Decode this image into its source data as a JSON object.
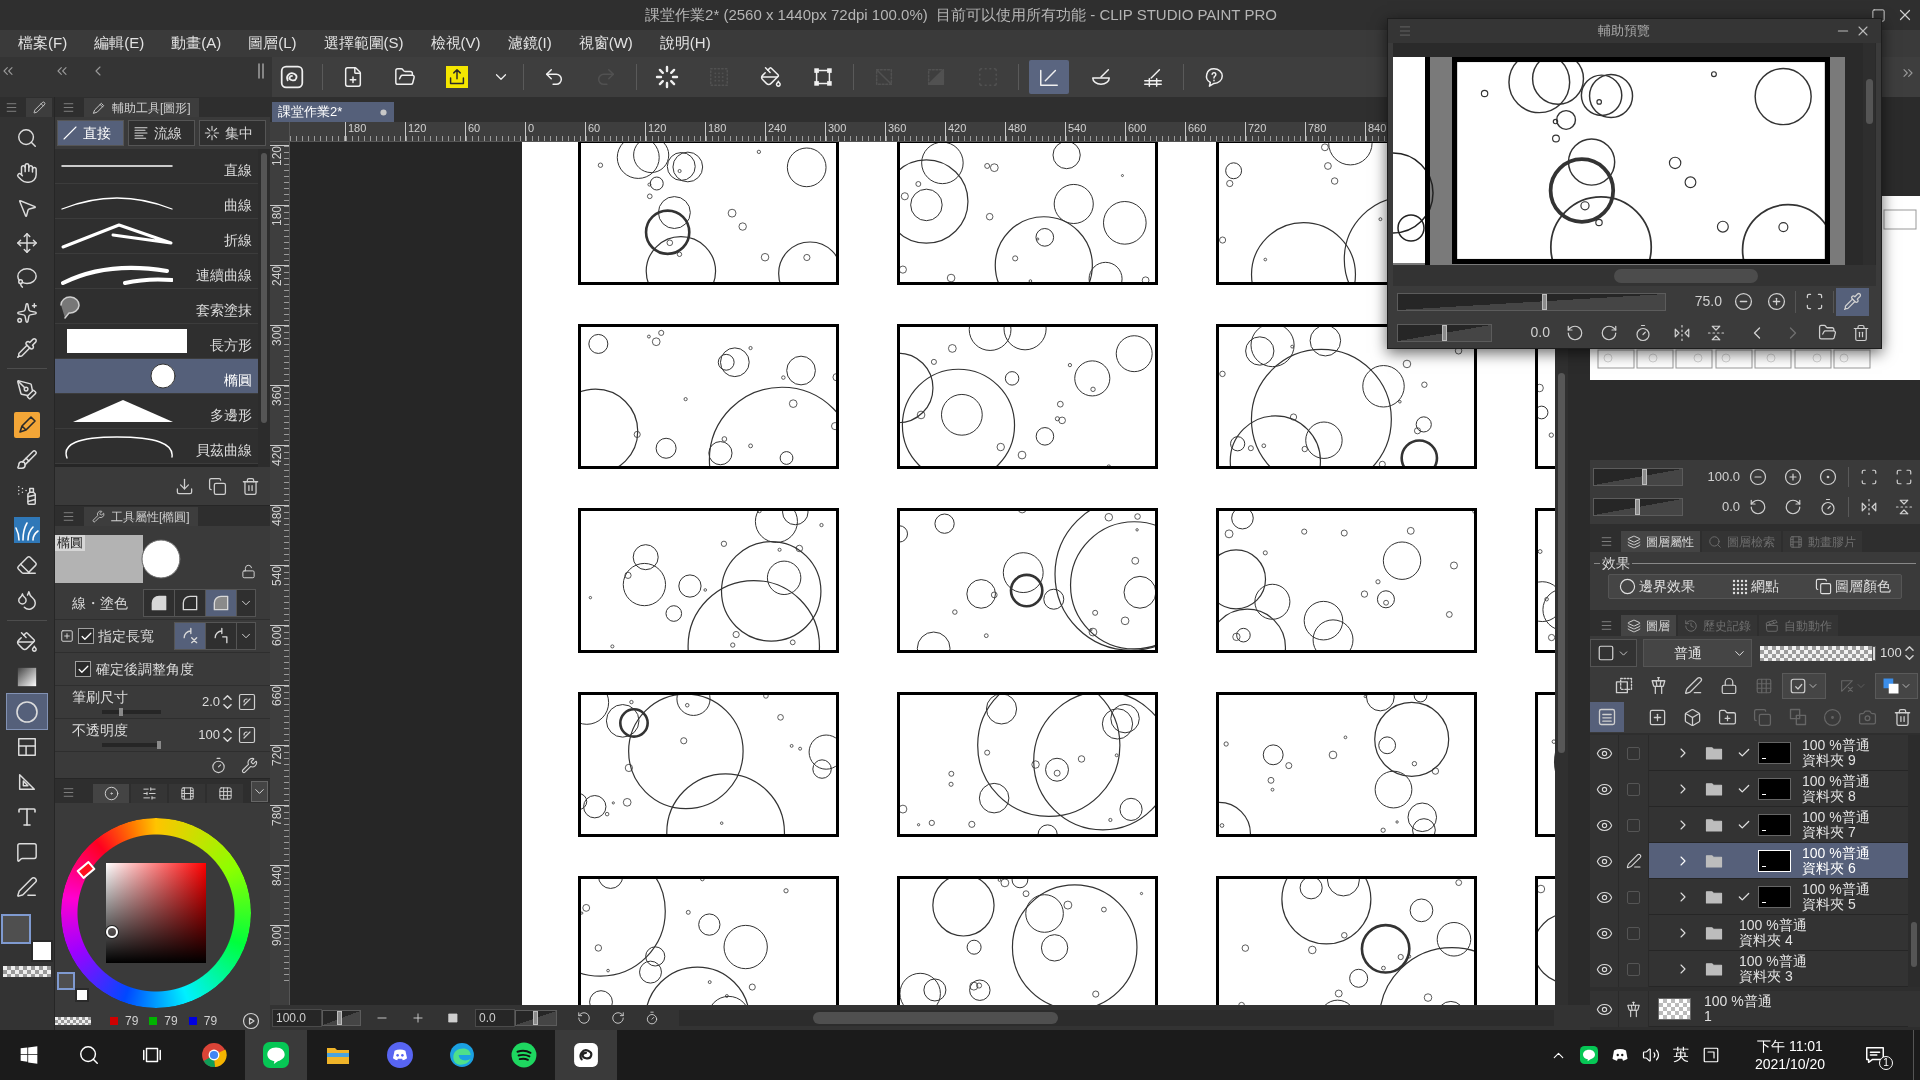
{
  "window": {
    "title": "課堂作業2* (2560 x 1440px 72dpi 100.0%)  目前可以使用所有功能 - CLIP STUDIO PAINT PRO"
  },
  "menu": [
    "檔案(F)",
    "編輯(E)",
    "動畫(A)",
    "圖層(L)",
    "選擇範圍(S)",
    "檢視(V)",
    "濾鏡(I)",
    "視窗(W)",
    "說明(H)"
  ],
  "command_bar": {
    "groups": [
      {
        "items": [
          {
            "kind": "logo",
            "disabled": false,
            "selected": false
          }
        ]
      },
      {
        "items": [
          {
            "kind": "new",
            "disabled": false,
            "selected": false
          },
          {
            "kind": "open",
            "disabled": false,
            "selected": false
          },
          {
            "kind": "save",
            "disabled": false,
            "selected": false
          },
          {
            "kind": "caret",
            "disabled": false,
            "selected": false
          }
        ]
      },
      {
        "items": [
          {
            "kind": "undo",
            "disabled": false,
            "selected": false
          },
          {
            "kind": "redo",
            "disabled": true,
            "selected": false
          }
        ]
      },
      {
        "items": [
          {
            "kind": "clear",
            "disabled": false,
            "selected": false
          },
          {
            "kind": "clear-outside",
            "disabled": true,
            "selected": false
          },
          {
            "kind": "fill",
            "disabled": false,
            "selected": false
          },
          {
            "kind": "transform",
            "disabled": false,
            "selected": false
          }
        ]
      },
      {
        "items": [
          {
            "kind": "deselect",
            "disabled": true,
            "selected": false
          },
          {
            "kind": "invert",
            "disabled": true,
            "selected": false
          },
          {
            "kind": "show-selection",
            "disabled": true,
            "selected": false
          }
        ]
      },
      {
        "items": [
          {
            "kind": "snap-ruler",
            "disabled": false,
            "selected": true
          },
          {
            "kind": "snap-special",
            "disabled": false,
            "selected": false
          },
          {
            "kind": "snap-grid",
            "disabled": false,
            "selected": false
          }
        ]
      },
      {
        "items": [
          {
            "kind": "help",
            "disabled": false,
            "selected": false
          }
        ]
      }
    ]
  },
  "tools": {
    "groups": [
      {
        "items": [
          {
            "kind": "zoom",
            "selected": false
          },
          {
            "kind": "hand",
            "selected": false
          },
          {
            "kind": "object",
            "selected": false
          },
          {
            "kind": "move",
            "selected": false
          },
          {
            "kind": "lasso",
            "selected": false
          },
          {
            "kind": "wand",
            "selected": false
          },
          {
            "kind": "eyedropper",
            "selected": false
          }
        ]
      },
      {
        "items": [
          {
            "kind": "pen",
            "selected": false
          },
          {
            "kind": "pencil",
            "selected": false
          },
          {
            "kind": "brush",
            "selected": false
          },
          {
            "kind": "airbrush",
            "selected": false
          },
          {
            "kind": "decoration",
            "selected": false
          },
          {
            "kind": "eraser",
            "selected": false
          },
          {
            "kind": "blend",
            "selected": false
          }
        ]
      },
      {
        "items": [
          {
            "kind": "fill",
            "selected": false
          },
          {
            "kind": "gradient",
            "selected": false
          },
          {
            "kind": "figure",
            "selected": true
          },
          {
            "kind": "frame",
            "selected": false
          },
          {
            "kind": "ruler",
            "selected": false
          },
          {
            "kind": "text",
            "selected": false
          },
          {
            "kind": "balloon",
            "selected": false
          },
          {
            "kind": "correct",
            "selected": false
          }
        ]
      }
    ]
  },
  "tool_swatches": [
    {
      "color": "#4f4f4f",
      "selected": true
    },
    {
      "color": "#ffffff",
      "selected": false
    }
  ],
  "sub_tool": {
    "title": "輔助工具[圖形]",
    "groups": [
      {
        "kind": "line",
        "label": "直接",
        "selected": true
      },
      {
        "kind": "stream",
        "label": "流線",
        "selected": false
      },
      {
        "kind": "focus",
        "label": "集中",
        "selected": false
      }
    ],
    "items": [
      {
        "kind": "line",
        "label": "直線",
        "selected": false
      },
      {
        "kind": "curve",
        "label": "曲線",
        "selected": false
      },
      {
        "kind": "polyline",
        "label": "折線",
        "selected": false
      },
      {
        "kind": "continuous",
        "label": "連續曲線",
        "selected": false
      },
      {
        "kind": "lasso-fill",
        "label": "套索塗抹",
        "selected": false
      },
      {
        "kind": "rectangle",
        "label": "長方形",
        "selected": false
      },
      {
        "kind": "ellipse",
        "label": "橢圓",
        "selected": true
      },
      {
        "kind": "polygon",
        "label": "多邊形",
        "selected": false
      },
      {
        "kind": "bezier",
        "label": "貝茲曲線",
        "selected": false
      }
    ]
  },
  "tool_property": {
    "title": "工具屬性[橢圓]",
    "preview_label": "橢圓",
    "rows": [
      {
        "kind": "options",
        "label": "線・塗色",
        "options": [
          {
            "kind": "fill",
            "selected": false
          },
          {
            "kind": "line",
            "selected": false
          },
          {
            "kind": "line-fill",
            "selected": true
          }
        ]
      },
      {
        "kind": "check-options",
        "label": "指定長寬",
        "checked": true,
        "options": [
          {
            "kind": "ratio",
            "selected": true
          },
          {
            "kind": "pixels",
            "selected": false
          }
        ]
      },
      {
        "kind": "check",
        "label": "確定後調整角度",
        "checked": true
      },
      {
        "kind": "slider",
        "label": "筆刷尺寸",
        "value": "2.0",
        "level": 0.3
      },
      {
        "kind": "slider",
        "label": "不透明度",
        "value": "100",
        "level": 1
      }
    ]
  },
  "color_panel": {
    "tabs": [
      {
        "kind": "wheel",
        "selected": true
      },
      {
        "kind": "sliders",
        "selected": false
      },
      {
        "kind": "set",
        "selected": false
      },
      {
        "kind": "history",
        "selected": false
      }
    ],
    "swatches": [
      {
        "color": "#4f4f4f",
        "selected": true
      },
      {
        "color": "#ffffff",
        "selected": false
      }
    ],
    "rgb": [
      {
        "value": "79",
        "color": "#d00000"
      },
      {
        "value": "79",
        "color": "#00b400"
      },
      {
        "value": "79",
        "color": "#0000e0"
      }
    ]
  },
  "document_tab": {
    "label": "課堂作業2*"
  },
  "rulers": {
    "horizontal": [
      "180",
      "120",
      "60",
      "0",
      "60",
      "120",
      "180",
      "240",
      "300",
      "360",
      "420",
      "480",
      "540",
      "600",
      "660",
      "720",
      "780",
      "840"
    ],
    "vertical": [
      "120",
      "180",
      "240",
      "300",
      "360",
      "420",
      "480",
      "540",
      "600",
      "660",
      "720",
      "780",
      "840",
      "900"
    ]
  },
  "canvas_status": {
    "zoom": {
      "value": "100.0",
      "level": 0.45
    },
    "rotation": {
      "value": "0.0",
      "level": 0.5
    }
  },
  "navigator": {
    "zoom": {
      "value": "100.0",
      "level": 0.58
    },
    "rotation": {
      "value": "0.0",
      "level": 0.5
    }
  },
  "layer_property": {
    "tabs": [
      {
        "kind": "property",
        "label": "圖層屬性",
        "selected": true
      },
      {
        "kind": "search",
        "label": "圖層檢索",
        "selected": false
      },
      {
        "kind": "cels",
        "label": "動畫膠片",
        "selected": false
      }
    ],
    "section": "效果",
    "effects": [
      {
        "kind": "border",
        "label": "邊界效果",
        "on": false
      },
      {
        "kind": "tone",
        "label": "網點",
        "on": false
      },
      {
        "kind": "layer-color",
        "label": "圖層顏色",
        "on": false
      }
    ]
  },
  "layers": {
    "tabs": [
      {
        "kind": "layers",
        "label": "圖層",
        "selected": true
      },
      {
        "kind": "history",
        "label": "歷史記錄",
        "selected": false
      },
      {
        "kind": "actions",
        "label": "自動動作",
        "selected": false
      }
    ],
    "blend_mode": "普通",
    "opacity": {
      "value": "100",
      "level": 1
    },
    "items": [
      {
        "kind": "folder",
        "mode": "100 %普通",
        "name": "資料夾 9",
        "visible": true,
        "selected": false,
        "checked": false,
        "expanded": false,
        "mask": true,
        "mask_on": true
      },
      {
        "kind": "folder",
        "mode": "100 %普通",
        "name": "資料夾 8",
        "visible": true,
        "selected": false,
        "checked": false,
        "expanded": false,
        "mask": true,
        "mask_on": true
      },
      {
        "kind": "folder",
        "mode": "100 %普通",
        "name": "資料夾 7",
        "visible": true,
        "selected": false,
        "checked": false,
        "expanded": false,
        "mask": true,
        "mask_on": true
      },
      {
        "kind": "folder",
        "mode": "100 %普通",
        "name": "資料夾 6",
        "visible": true,
        "selected": true,
        "expanded": false,
        "mask": true,
        "mask_on": false
      },
      {
        "kind": "folder",
        "mode": "100 %普通",
        "name": "資料夾 5",
        "visible": true,
        "selected": false,
        "checked": false,
        "expanded": false,
        "mask": true,
        "mask_on": true
      },
      {
        "kind": "folder",
        "mode": "100 %普通",
        "name": "資料夾 4",
        "visible": true,
        "selected": false,
        "checked": false,
        "expanded": false,
        "mask": false
      },
      {
        "kind": "folder",
        "mode": "100 %普通",
        "name": "資料夾 3",
        "visible": true,
        "selected": false,
        "checked": false,
        "expanded": false,
        "mask": false
      }
    ],
    "base": {
      "kind": "layer",
      "mode": "100 %普通",
      "name": "1",
      "visible": true,
      "selected": false,
      "reference": true
    }
  },
  "sub_view": {
    "title": "輔助預覽",
    "zoom": {
      "value": "75.0",
      "level": 0.55
    },
    "rotation": {
      "value": "0.0",
      "level": 0.5
    },
    "zoom_buttons": [
      {
        "kind": "zoom-out",
        "selected": false
      },
      {
        "kind": "zoom-in",
        "selected": false
      },
      {
        "kind": "fit",
        "selected": false
      },
      {
        "kind": "eyedropper",
        "selected": true
      }
    ],
    "view_buttons": [
      {
        "kind": "rotate-left",
        "disabled": false
      },
      {
        "kind": "rotate-right",
        "disabled": false
      },
      {
        "kind": "reset",
        "disabled": false
      },
      {
        "kind": "flip-h",
        "disabled": false
      },
      {
        "kind": "flip-v",
        "disabled": false
      },
      {
        "kind": "prev",
        "disabled": false
      },
      {
        "kind": "next",
        "disabled": true
      },
      {
        "kind": "import",
        "disabled": false
      },
      {
        "kind": "delete",
        "disabled": false
      }
    ]
  },
  "taskbar": {
    "apps": [
      {
        "kind": "browser",
        "active": false
      },
      {
        "kind": "line",
        "active": true
      },
      {
        "kind": "explorer",
        "active": false
      },
      {
        "kind": "discord",
        "active": false
      },
      {
        "kind": "edge",
        "active": false
      },
      {
        "kind": "spotify",
        "active": false
      },
      {
        "kind": "clip-studio",
        "active": true
      }
    ],
    "ime": "英",
    "time": "下午 11:01",
    "date": "2021/10/20",
    "notifications": "1"
  }
}
